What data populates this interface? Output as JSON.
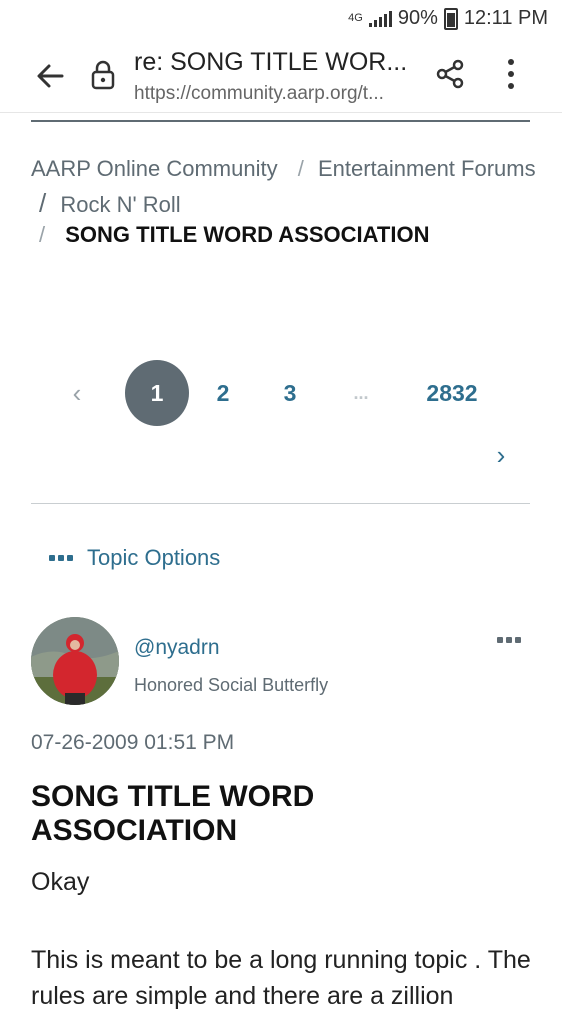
{
  "status_bar": {
    "network": "4G",
    "battery": "90%",
    "time": "12:11 PM"
  },
  "browser": {
    "page_title": "re: SONG TITLE WOR...",
    "url": "https://community.aarp.org/t..."
  },
  "breadcrumb": {
    "items": [
      "AARP Online Community",
      "Entertainment Forums",
      "Rock N' Roll",
      "SONG TITLE WORD ASSOCIATION"
    ],
    "separator": "/"
  },
  "pagination": {
    "prev": "‹",
    "pages": [
      "1",
      "2",
      "3"
    ],
    "ellipsis": "...",
    "last": "2832",
    "next": "›",
    "current": "1"
  },
  "topic_options": {
    "label": "Topic Options"
  },
  "post": {
    "author": "@nyadrn",
    "rank": "Honored Social Butterfly",
    "date": "07-26-2009 01:51 PM",
    "title": "SONG TITLE WORD ASSOCIATION",
    "body_line1": "Okay",
    "body_line2": "This is meant to be a long running topic . The rules are simple and there are a zillion"
  },
  "colors": {
    "link": "#2e6e8e",
    "muted": "#5f6b73",
    "active_page_bg": "#5f6b73"
  }
}
